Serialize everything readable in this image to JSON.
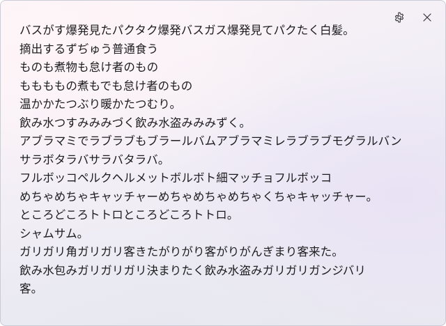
{
  "controls": {
    "settings_icon": "gear-icon",
    "close_icon": "close-icon"
  },
  "lines": [
    "バスがす爆発見たパクタク爆発バスガス爆発見てパクたく白髪。",
    "摘出するずぢゅう普通食う",
    "ものも煮物も怠け者のもの",
    "ももももの煮もでも怠け者のもの",
    "温かかたつぶり暖かたつむり。",
    "飲み水つすみみみづく飲み水盗みみみずく。",
    "アブラマミでラブラブもブラールバムアブラマミレラブラブモグラルバン",
    "サラボタラバサラバタラバ。",
    "フルボッコペルクヘルメットボルボト細マッチョフルボッコ",
    "めちゃめちゃキャッチャーめちゃめちゃめちゃくちゃキャッチャー。",
    "ところどころトトロところどころトトロ。",
    "シャムサム。",
    "ガリガリ角ガリガリ客きたがりがり客がりがんぎまり客来た。",
    "飲み水包みガリガリガリ決まりたく飲み水盗みガリガリガンジバリ",
    "客。"
  ]
}
